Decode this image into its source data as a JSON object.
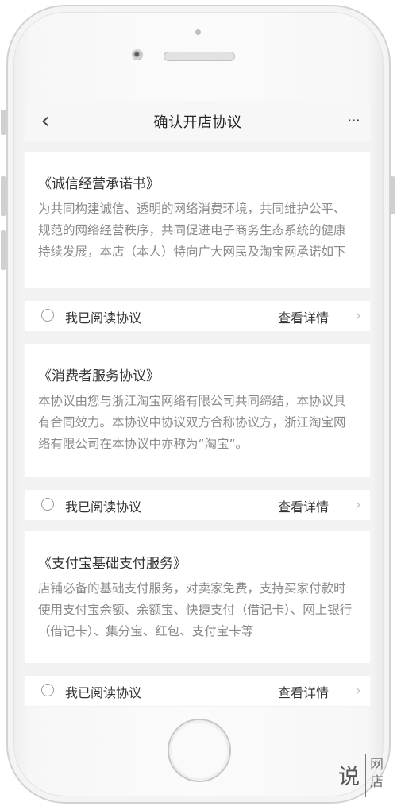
{
  "nav": {
    "back_icon": "‹",
    "title": "确认开店协议",
    "more_icon": "···"
  },
  "agreements": [
    {
      "title": "《诚信经营承诺书》",
      "body": "为共同构建诚信、透明的网络消费环境，共同维护公平、规范的网络经营秩序，共同促进电子商务生态系统的健康持续发展，本店（本人）特向广大网民及淘宝网承诺如下",
      "read_label": "我已阅读协议",
      "detail_label": "查看详情"
    },
    {
      "title": "《消费者服务协议》",
      "body": "本协议由您与浙江淘宝网络有限公司共同缔结，本协议具有合同效力。本协议中协议双方合称协议方，浙江淘宝网络有限公司在本协议中亦称为“淘宝”。",
      "read_label": "我已阅读协议",
      "detail_label": "查看详情"
    },
    {
      "title": "《支付宝基础支付服务》",
      "body": "店铺必备的基础支付服务，对卖家免费，支持买家付款时使用支付宝余额、余额宝、快捷支付（借记卡）、网上银行（借记卡）、集分宝、红包、支付宝卡等",
      "read_label": "我已阅读协议",
      "detail_label": "查看详情"
    }
  ],
  "chevron_icon": "›",
  "watermark": {
    "big": "说",
    "small_top": "网",
    "small_bottom": "店"
  }
}
